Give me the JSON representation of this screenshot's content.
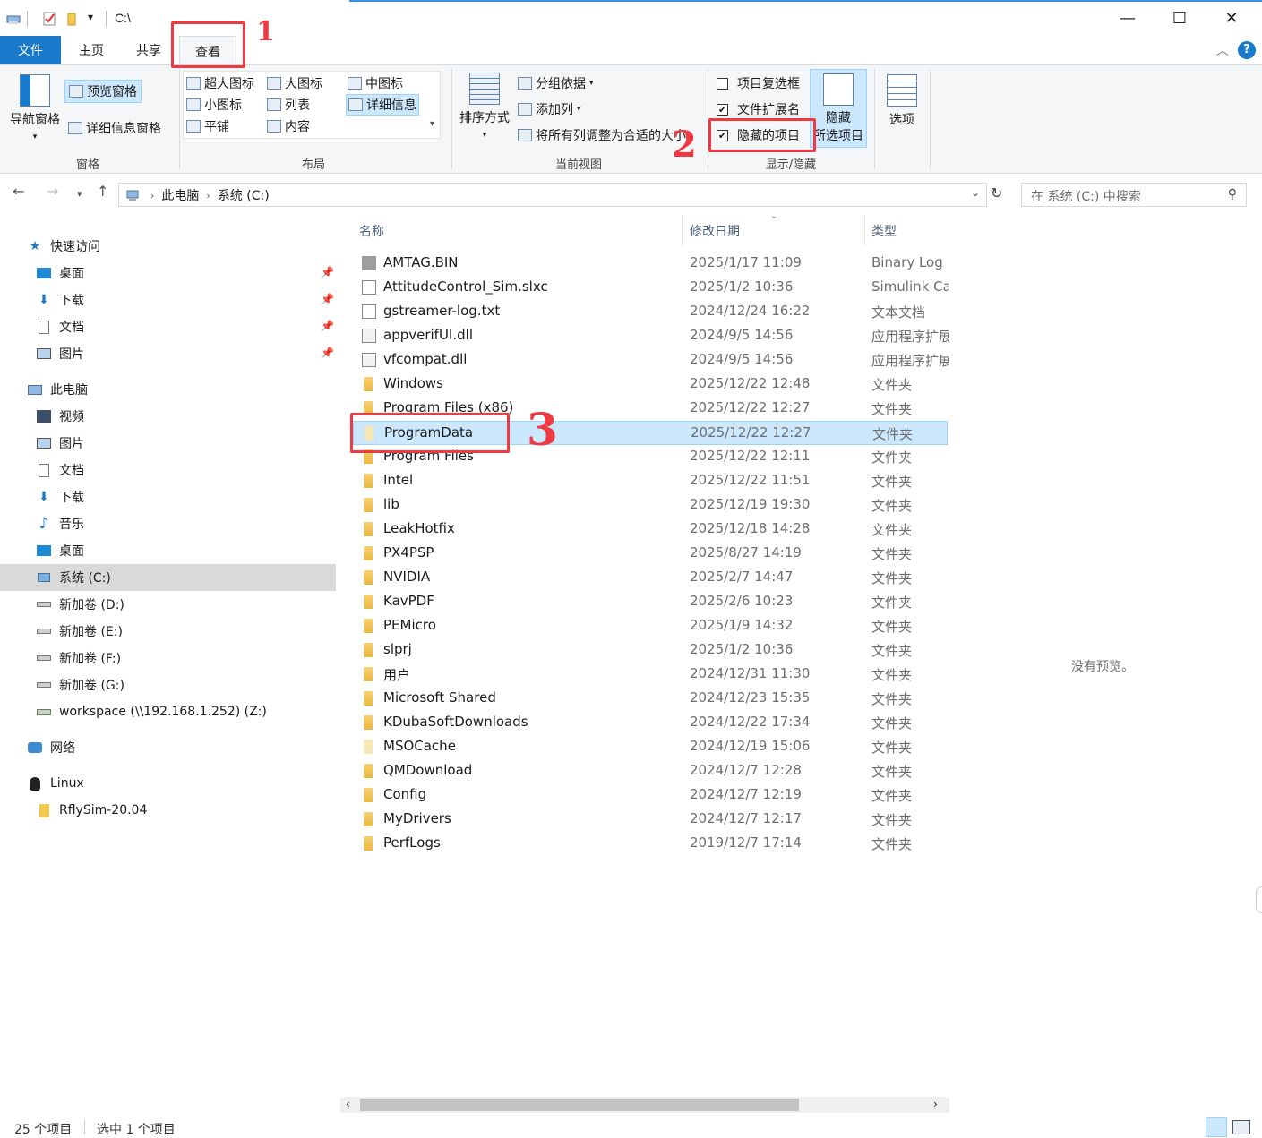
{
  "window": {
    "title": "C:\\",
    "minimize": "—",
    "maximize": "☐",
    "close": "✕",
    "quick_access_dropdown": "▾"
  },
  "tabs": {
    "file": "文件",
    "home": "主页",
    "share": "共享",
    "view": "查看",
    "collapse": "︿",
    "help": "?"
  },
  "annotations": {
    "one": "1",
    "two": "2",
    "three": "3"
  },
  "ribbon": {
    "pane": {
      "label": "窗格",
      "nav_pane": "导航窗格",
      "preview_pane": "预览窗格",
      "details_pane": "详细信息窗格"
    },
    "layout": {
      "label": "布局",
      "extra_large": "超大图标",
      "large": "大图标",
      "medium": "中图标",
      "small": "小图标",
      "list": "列表",
      "details": "详细信息",
      "tiles": "平铺",
      "content": "内容"
    },
    "current_view": {
      "label": "当前视图",
      "sort_by": "排序方式",
      "group_by": "分组依据",
      "add_columns": "添加列",
      "fit_columns": "将所有列调整为合适的大小"
    },
    "show_hide": {
      "label": "显示/隐藏",
      "item_checkboxes": "项目复选框",
      "item_checkboxes_checked": false,
      "file_extensions": "文件扩展名",
      "file_extensions_checked": true,
      "hidden_items": "隐藏的项目",
      "hidden_items_checked": true,
      "hide_selected": "隐藏\n所选项目"
    },
    "options": "选项"
  },
  "address": {
    "crumbs": [
      "此电脑",
      "系统 (C:)"
    ],
    "search_placeholder": "在 系统 (C:) 中搜索"
  },
  "nav_pane": {
    "quick_access": "快速访问",
    "quick_items": [
      "桌面",
      "下载",
      "文档",
      "图片"
    ],
    "this_pc": "此电脑",
    "pc_items": [
      "视频",
      "图片",
      "文档",
      "下载",
      "音乐",
      "桌面",
      "系统 (C:)",
      "新加卷 (D:)",
      "新加卷 (E:)",
      "新加卷 (F:)",
      "新加卷 (G:)",
      "workspace (\\\\192.168.1.252) (Z:)"
    ],
    "network": "网络",
    "linux": "Linux",
    "linux_items": [
      "RflySim-20.04"
    ]
  },
  "columns": {
    "name": "名称",
    "date": "修改日期",
    "type": "类型"
  },
  "files": [
    {
      "name": "AMTAG.BIN",
      "date": "2025/1/17 11:09",
      "type": "Binary Log",
      "icon": "bin"
    },
    {
      "name": "AttitudeControl_Sim.slxc",
      "date": "2025/1/2 10:36",
      "type": "Simulink Cache",
      "icon": "slx"
    },
    {
      "name": "gstreamer-log.txt",
      "date": "2024/12/24 16:22",
      "type": "文本文档",
      "icon": "doc"
    },
    {
      "name": "appverifUI.dll",
      "date": "2024/9/5 14:56",
      "type": "应用程序扩展",
      "icon": "dll"
    },
    {
      "name": "vfcompat.dll",
      "date": "2024/9/5 14:56",
      "type": "应用程序扩展",
      "icon": "dll"
    },
    {
      "name": "Windows",
      "date": "2025/12/22 12:48",
      "type": "文件夹",
      "icon": "folder"
    },
    {
      "name": "Program Files (x86)",
      "date": "2025/12/22 12:27",
      "type": "文件夹",
      "icon": "folder"
    },
    {
      "name": "ProgramData",
      "date": "2025/12/22 12:27",
      "type": "文件夹",
      "icon": "folder-pale",
      "selected": true
    },
    {
      "name": "Program Files",
      "date": "2025/12/22 12:11",
      "type": "文件夹",
      "icon": "folder"
    },
    {
      "name": "Intel",
      "date": "2025/12/22 11:51",
      "type": "文件夹",
      "icon": "folder"
    },
    {
      "name": "lib",
      "date": "2025/12/19 19:30",
      "type": "文件夹",
      "icon": "folder"
    },
    {
      "name": "LeakHotfix",
      "date": "2025/12/18 14:28",
      "type": "文件夹",
      "icon": "folder"
    },
    {
      "name": "PX4PSP",
      "date": "2025/8/27 14:19",
      "type": "文件夹",
      "icon": "folder"
    },
    {
      "name": "NVIDIA",
      "date": "2025/2/7 14:47",
      "type": "文件夹",
      "icon": "folder"
    },
    {
      "name": "KavPDF",
      "date": "2025/2/6 10:23",
      "type": "文件夹",
      "icon": "folder"
    },
    {
      "name": "PEMicro",
      "date": "2025/1/9 14:32",
      "type": "文件夹",
      "icon": "folder"
    },
    {
      "name": "slprj",
      "date": "2025/1/2 10:36",
      "type": "文件夹",
      "icon": "folder"
    },
    {
      "name": "用户",
      "date": "2024/12/31 11:30",
      "type": "文件夹",
      "icon": "folder"
    },
    {
      "name": "Microsoft Shared",
      "date": "2024/12/23 15:35",
      "type": "文件夹",
      "icon": "folder"
    },
    {
      "name": "KDubaSoftDownloads",
      "date": "2024/12/22 17:34",
      "type": "文件夹",
      "icon": "folder"
    },
    {
      "name": "MSOCache",
      "date": "2024/12/19 15:06",
      "type": "文件夹",
      "icon": "folder-pale"
    },
    {
      "name": "QMDownload",
      "date": "2024/12/7 12:28",
      "type": "文件夹",
      "icon": "folder"
    },
    {
      "name": "Config",
      "date": "2024/12/7 12:19",
      "type": "文件夹",
      "icon": "folder"
    },
    {
      "name": "MyDrivers",
      "date": "2024/12/7 12:17",
      "type": "文件夹",
      "icon": "folder"
    },
    {
      "name": "PerfLogs",
      "date": "2019/12/7 17:14",
      "type": "文件夹",
      "icon": "folder"
    }
  ],
  "preview": {
    "empty_text": "没有预览。"
  },
  "status": {
    "count": "25 个项目",
    "selected": "选中 1 个项目"
  },
  "colors": {
    "file_tab": "#1979ca",
    "selection": "#cce8ff",
    "annotation_red": "#ee3a43"
  }
}
